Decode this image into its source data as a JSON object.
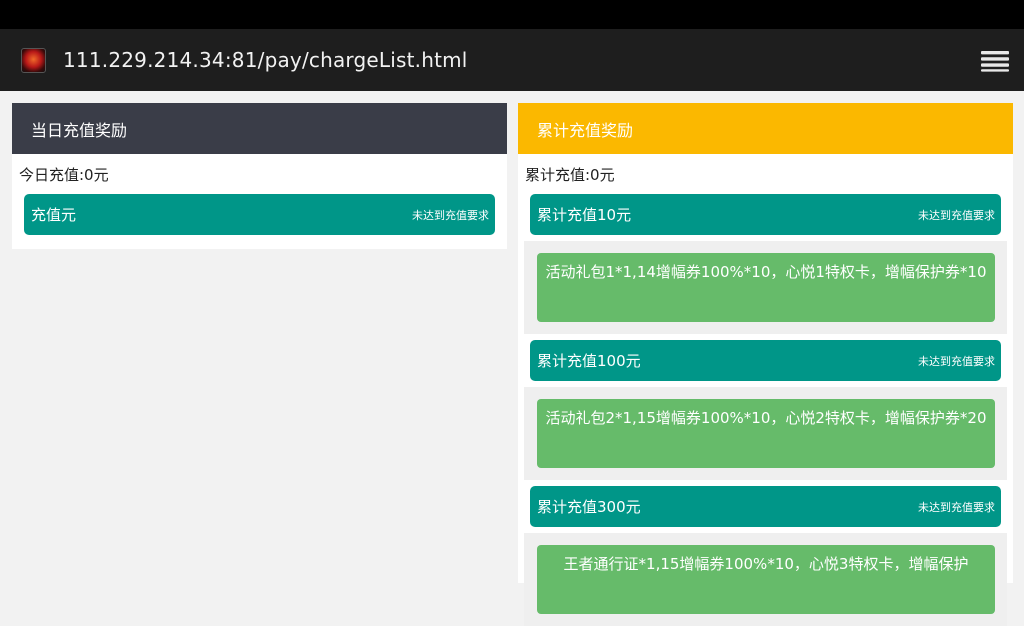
{
  "browser": {
    "url": "111.229.214.34:81/pay/chargeList.html",
    "favicon": "game-favicon-icon",
    "menu": "menu-icon"
  },
  "daily": {
    "title": "当日充值奖励",
    "summary": "今日充值:0元",
    "tier": {
      "label": "充值元",
      "status": "未达到充值要求"
    }
  },
  "cumulative": {
    "title": "累计充值奖励",
    "summary": "累计充值:0元",
    "tiers": [
      {
        "label": "累计充值10元",
        "status": "未达到充值要求",
        "reward": "活动礼包1*1,14增幅券100%*10，心悦1特权卡，增幅保护券*10"
      },
      {
        "label": "累计充值100元",
        "status": "未达到充值要求",
        "reward": "活动礼包2*1,15增幅券100%*10，心悦2特权卡，增幅保护券*20"
      },
      {
        "label": "累计充值300元",
        "status": "未达到充值要求",
        "reward": "王者通行证*1,15增幅券100%*10，心悦3特权卡，增幅保护"
      }
    ]
  },
  "colors": {
    "daily_header": "#3a3d48",
    "cumulative_header": "#fbb800",
    "tier_bar": "#009688",
    "reward_box": "#66bb6a"
  }
}
